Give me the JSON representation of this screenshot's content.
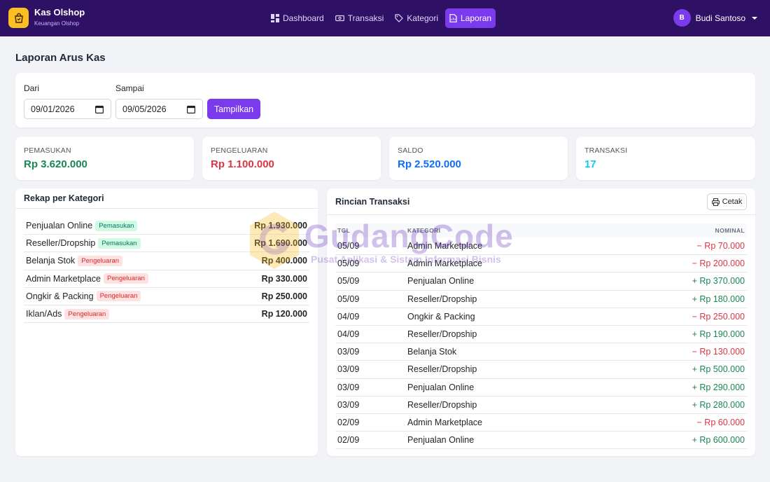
{
  "brand": {
    "title": "Kas Olshop",
    "subtitle": "Keuangan Olshop"
  },
  "nav": [
    {
      "label": "Dashboard",
      "icon": "grid-icon",
      "active": false
    },
    {
      "label": "Transaksi",
      "icon": "cash-icon",
      "active": false
    },
    {
      "label": "Kategori",
      "icon": "tag-icon",
      "active": false
    },
    {
      "label": "Laporan",
      "icon": "report-icon",
      "active": true
    }
  ],
  "user": {
    "initial": "B",
    "name": "Budi Santoso"
  },
  "page": {
    "title": "Laporan Arus Kas"
  },
  "filter": {
    "from_label": "Dari",
    "from_value": "09/01/2026",
    "to_label": "Sampai",
    "to_value": "09/05/2026",
    "button": "Tampilkan"
  },
  "stats": [
    {
      "label": "PEMASUKAN",
      "value": "Rp 3.620.000",
      "color": "#198754"
    },
    {
      "label": "PENGELUARAN",
      "value": "Rp 1.100.000",
      "color": "#dc3545"
    },
    {
      "label": "SALDO",
      "value": "Rp 2.520.000",
      "color": "#0d6efd"
    },
    {
      "label": "TRANSAKSI",
      "value": "17",
      "color": "#0dcaf0"
    }
  ],
  "category_card": {
    "title": "Rekap per Kategori",
    "rows": [
      {
        "name": "Penjualan Online",
        "badge": "Pemasukan",
        "type": "in",
        "amount": "Rp 1.930.000"
      },
      {
        "name": "Reseller/Dropship",
        "badge": "Pemasukan",
        "type": "in",
        "amount": "Rp 1.690.000"
      },
      {
        "name": "Belanja Stok",
        "badge": "Pengeluaran",
        "type": "out",
        "amount": "Rp 400.000"
      },
      {
        "name": "Admin Marketplace",
        "badge": "Pengeluaran",
        "type": "out",
        "amount": "Rp 330.000"
      },
      {
        "name": "Ongkir & Packing",
        "badge": "Pengeluaran",
        "type": "out",
        "amount": "Rp 250.000"
      },
      {
        "name": "Iklan/Ads",
        "badge": "Pengeluaran",
        "type": "out",
        "amount": "Rp 120.000"
      }
    ]
  },
  "trx_card": {
    "title": "Rincian Transaksi",
    "print_button": "Cetak",
    "headers": {
      "date": "TGL",
      "category": "KATEGORI",
      "amount": "NOMINAL"
    },
    "rows": [
      {
        "date": "05/09",
        "category": "Admin Marketplace",
        "amount": "− Rp 70.000",
        "type": "neg"
      },
      {
        "date": "05/09",
        "category": "Admin Marketplace",
        "amount": "− Rp 200.000",
        "type": "neg"
      },
      {
        "date": "05/09",
        "category": "Penjualan Online",
        "amount": "+ Rp 370.000",
        "type": "pos"
      },
      {
        "date": "05/09",
        "category": "Reseller/Dropship",
        "amount": "+ Rp 180.000",
        "type": "pos"
      },
      {
        "date": "04/09",
        "category": "Ongkir & Packing",
        "amount": "− Rp 250.000",
        "type": "neg"
      },
      {
        "date": "04/09",
        "category": "Reseller/Dropship",
        "amount": "+ Rp 190.000",
        "type": "pos"
      },
      {
        "date": "03/09",
        "category": "Belanja Stok",
        "amount": "− Rp 130.000",
        "type": "neg"
      },
      {
        "date": "03/09",
        "category": "Reseller/Dropship",
        "amount": "+ Rp 500.000",
        "type": "pos"
      },
      {
        "date": "03/09",
        "category": "Penjualan Online",
        "amount": "+ Rp 290.000",
        "type": "pos"
      },
      {
        "date": "03/09",
        "category": "Reseller/Dropship",
        "amount": "+ Rp 280.000",
        "type": "pos"
      },
      {
        "date": "02/09",
        "category": "Admin Marketplace",
        "amount": "− Rp 60.000",
        "type": "neg"
      },
      {
        "date": "02/09",
        "category": "Penjualan Online",
        "amount": "+ Rp 600.000",
        "type": "pos"
      }
    ]
  },
  "watermark": {
    "title": "GudangCode",
    "subtitle": "Pusat Aplikasi & Sistem Informasi Bisnis"
  }
}
